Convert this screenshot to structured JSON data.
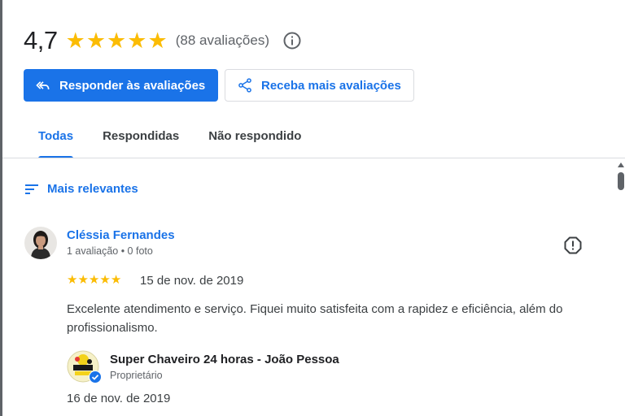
{
  "summary": {
    "rating": "4,7",
    "rating_stars": 5,
    "review_count": "(88 avaliações)"
  },
  "actions": {
    "reply_label": "Responder às avaliações",
    "get_more_label": "Receba mais avaliações"
  },
  "tabs": [
    {
      "label": "Todas",
      "active": true
    },
    {
      "label": "Respondidas",
      "active": false
    },
    {
      "label": "Não respondido",
      "active": false
    }
  ],
  "sort": {
    "label": "Mais relevantes"
  },
  "review": {
    "reviewer_name": "Cléssia Fernandes",
    "reviewer_meta": "1 avaliação • 0 foto",
    "stars": 5,
    "date": "15 de nov. de 2019",
    "text": "Excelente atendimento e serviço. Fiquei muito satisfeita com a rapidez e eficiência, além do profissionalismo.",
    "reply": {
      "owner_name": "Super Chaveiro 24 horas - João Pessoa",
      "owner_role": "Proprietário",
      "date": "16 de nov. de 2019"
    }
  },
  "colors": {
    "accent": "#1a73e8",
    "star": "#fbbc04",
    "text_secondary": "#5f6368"
  },
  "icons": [
    "reply-all-icon",
    "share-icon",
    "info-icon",
    "sort-icon",
    "report-icon",
    "verified-icon"
  ]
}
